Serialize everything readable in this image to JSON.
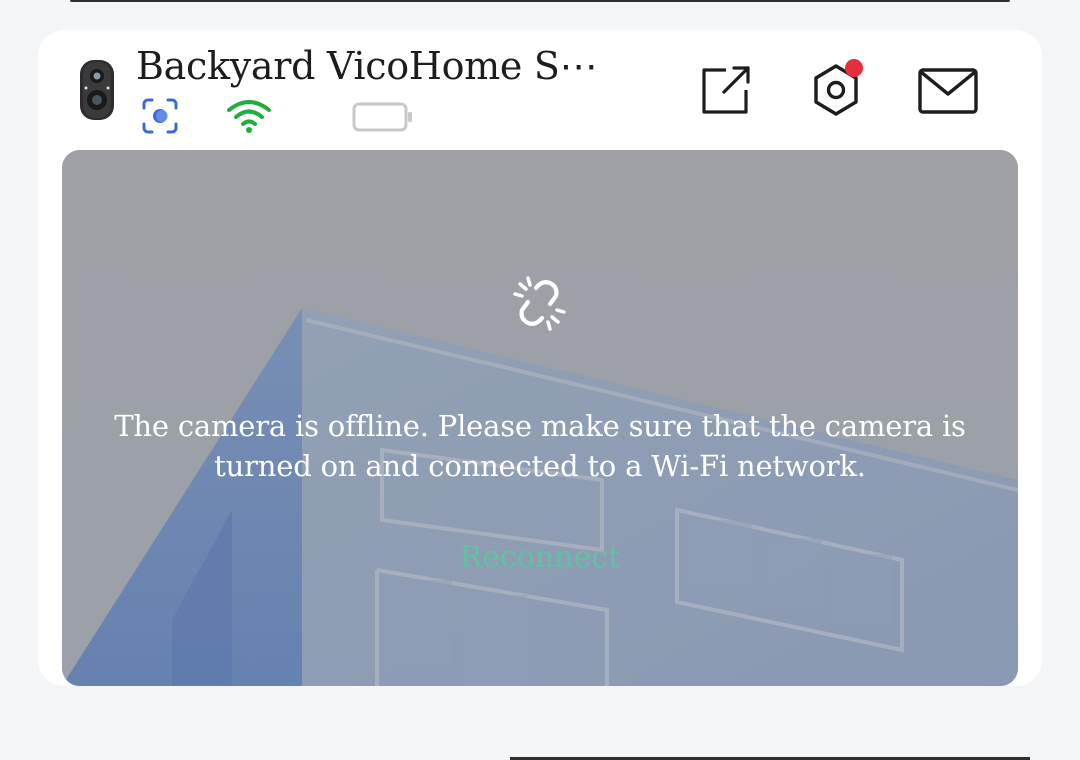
{
  "device": {
    "name": "Backyard VicoHome S⋯",
    "thumbnail_icon": "camera-device-icon",
    "status_icons": [
      "motion-detection-icon",
      "wifi-icon",
      "battery-icon"
    ],
    "wifi_color": "#1fae3a"
  },
  "actions": [
    {
      "icon": "share-icon",
      "label": "Share"
    },
    {
      "icon": "settings-icon",
      "label": "Settings",
      "has_notification_dot": true
    },
    {
      "icon": "message-icon",
      "label": "Messages"
    }
  ],
  "preview": {
    "status_icon": "link-broken-icon",
    "message": "The camera is offline. Please make sure that the camera is turned on and connected to a Wi-Fi network.",
    "reconnect_label": "Reconnect",
    "accent_color": "#5bc8a0"
  }
}
